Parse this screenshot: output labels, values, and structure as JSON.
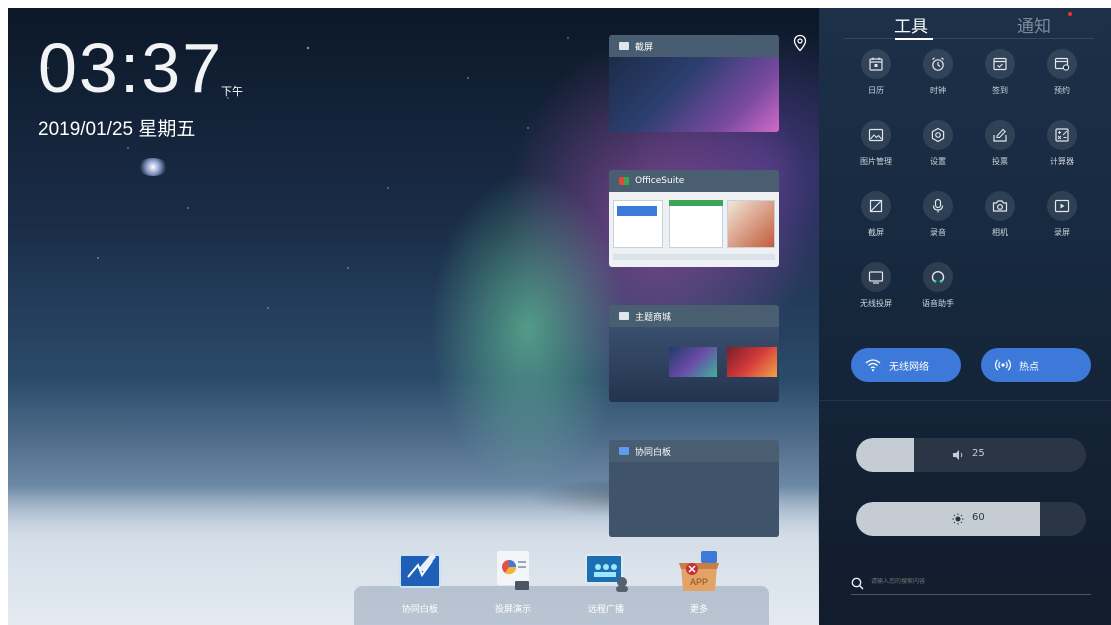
{
  "clock": {
    "time": "03:37",
    "ampm": "下午",
    "date": "2019/01/25  星期五"
  },
  "recent_cards": [
    {
      "title": "截屏"
    },
    {
      "title": "OfficeSuite"
    },
    {
      "title": "主题商城"
    },
    {
      "title": "协同白板"
    }
  ],
  "panel": {
    "tab_tools": "工具",
    "tab_notify": "通知",
    "tools": [
      {
        "label": "日历",
        "icon": "calendar-icon"
      },
      {
        "label": "时钟",
        "icon": "alarm-clock-icon"
      },
      {
        "label": "签到",
        "icon": "check-in-icon"
      },
      {
        "label": "预约",
        "icon": "reservation-icon"
      },
      {
        "label": "图片管理",
        "icon": "image-icon"
      },
      {
        "label": "设置",
        "icon": "settings-icon"
      },
      {
        "label": "投票",
        "icon": "vote-icon"
      },
      {
        "label": "计算器",
        "icon": "calculator-icon"
      },
      {
        "label": "截屏",
        "icon": "screenshot-icon"
      },
      {
        "label": "录音",
        "icon": "microphone-icon"
      },
      {
        "label": "相机",
        "icon": "camera-icon"
      },
      {
        "label": "录屏",
        "icon": "screen-record-icon"
      },
      {
        "label": "无线投屏",
        "icon": "wireless-cast-icon"
      },
      {
        "label": "语音助手",
        "icon": "voice-assistant-icon"
      }
    ],
    "wifi_label": "无线网络",
    "hotspot_label": "热点",
    "volume": {
      "value": "25",
      "level": 0.25
    },
    "brightness": {
      "value": "60",
      "level": 0.8
    },
    "search_placeholder": "请输入您的搜索内容"
  },
  "dock": [
    {
      "label": "协同白板"
    },
    {
      "label": "投屏演示"
    },
    {
      "label": "远程广播"
    },
    {
      "label": "更多",
      "icon_text": "APP"
    }
  ]
}
